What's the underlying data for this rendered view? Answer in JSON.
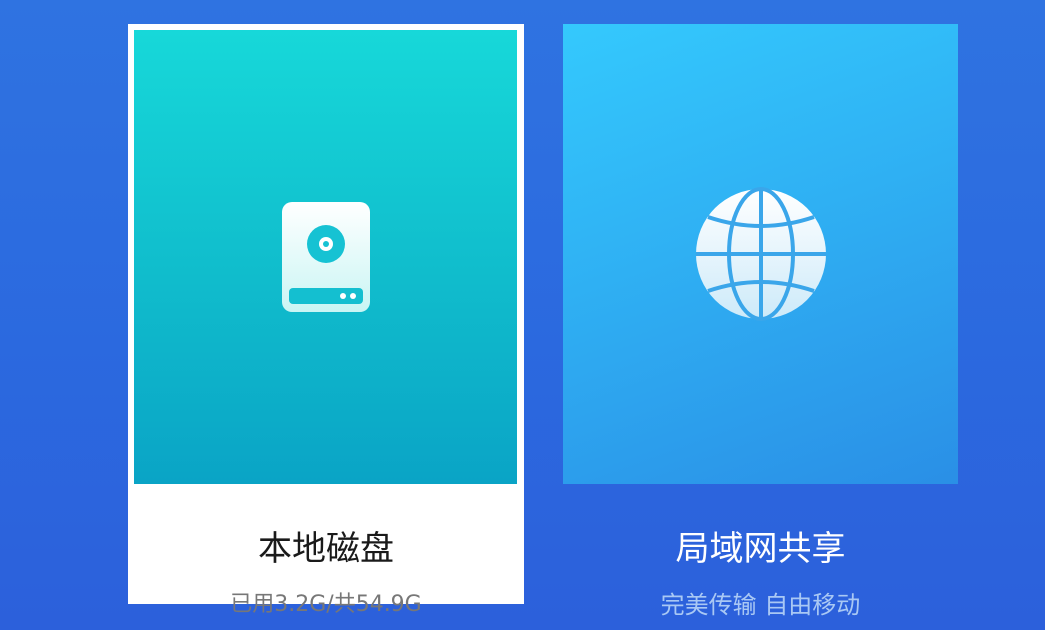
{
  "tiles": {
    "local": {
      "title": "本地磁盘",
      "subtitle": "已用3.2G/共54.9G",
      "icon": "hard-drive-icon",
      "selected": true
    },
    "lan": {
      "title": "局域网共享",
      "subtitle": "完美传输 自由移动",
      "icon": "globe-icon",
      "selected": false
    }
  },
  "colors": {
    "background": "#2e6be0",
    "local_accent": "#14c7d4",
    "lan_accent": "#30b2f4"
  }
}
